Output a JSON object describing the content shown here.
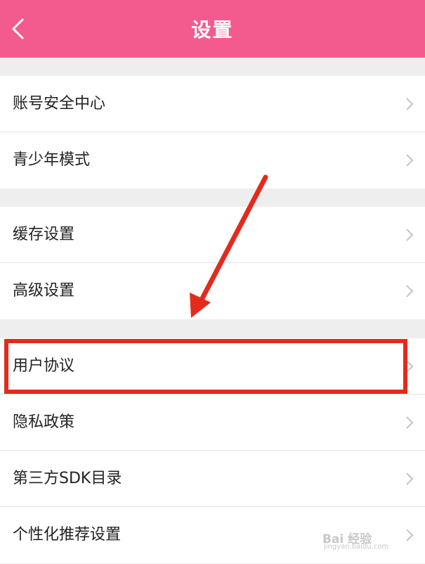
{
  "header": {
    "title": "设置"
  },
  "groups": [
    {
      "items": [
        {
          "label": "账号安全中心"
        },
        {
          "label": "青少年模式"
        }
      ]
    },
    {
      "items": [
        {
          "label": "缓存设置"
        },
        {
          "label": "高级设置"
        }
      ]
    },
    {
      "items": [
        {
          "label": "用户协议"
        },
        {
          "label": "隐私政策"
        },
        {
          "label": "第三方SDK目录"
        },
        {
          "label": "个性化推荐设置"
        }
      ]
    }
  ],
  "watermark": {
    "text": "Bai 经验",
    "sub": "jingyan.baidu.com"
  },
  "colors": {
    "header": "#f35b8f",
    "annotation": "#e42a1d",
    "background": "#eeeeee"
  },
  "icons": {
    "back": "chevron-left-icon",
    "row": "chevron-right-icon"
  }
}
